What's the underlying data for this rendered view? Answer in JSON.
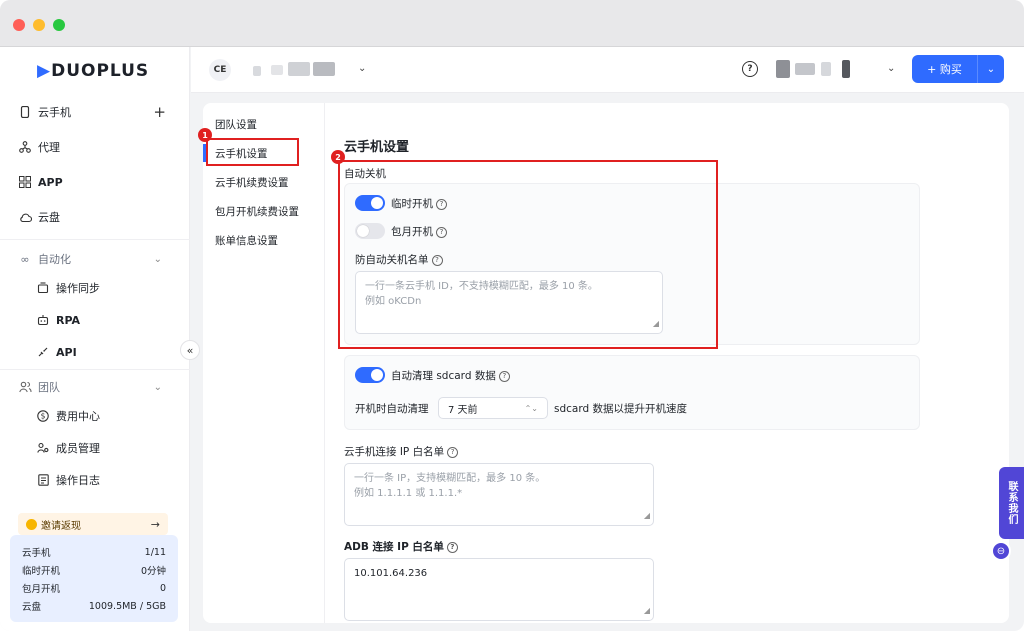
{
  "window": {
    "controls": [
      "close",
      "minimize",
      "maximize"
    ]
  },
  "sidebar": {
    "logo": "DUOPLUS",
    "items": [
      {
        "label": "云手机",
        "icon": "phone-icon",
        "action": "+"
      },
      {
        "label": "代理",
        "icon": "proxy-icon"
      },
      {
        "label": "APP",
        "icon": "grid-icon"
      },
      {
        "label": "云盘",
        "icon": "cloud-icon"
      }
    ],
    "automation": {
      "label": "自动化",
      "children": [
        {
          "label": "操作同步",
          "icon": "sync-icon"
        },
        {
          "label": "RPA",
          "icon": "robot-icon"
        },
        {
          "label": "API",
          "icon": "api-icon"
        }
      ]
    },
    "team": {
      "label": "团队",
      "children": [
        {
          "label": "费用中心",
          "icon": "dollar-icon"
        },
        {
          "label": "成员管理",
          "icon": "members-icon"
        },
        {
          "label": "操作日志",
          "icon": "log-icon"
        }
      ]
    },
    "collapse": "«",
    "invite": {
      "label": "邀请返现",
      "arrow": "→"
    },
    "stats": [
      {
        "label": "云手机",
        "value": "1/11"
      },
      {
        "label": "临时开机",
        "value": "0分钟"
      },
      {
        "label": "包月开机",
        "value": "0"
      },
      {
        "label": "云盘",
        "value": "1009.5MB / 5GB"
      }
    ]
  },
  "header": {
    "team_badge": "CE",
    "help": "?",
    "buy_label": "+ 购买"
  },
  "submenu": {
    "items": [
      "团队设置",
      "云手机设置",
      "云手机续费设置",
      "包月开机续费设置",
      "账单信息设置"
    ],
    "active_index": 1
  },
  "annotations": [
    "1",
    "2"
  ],
  "settings": {
    "title": "云手机设置",
    "auto_shutdown": {
      "label": "自动关机",
      "temp_boot": {
        "label": "临时开机",
        "enabled": true
      },
      "monthly_boot": {
        "label": "包月开机",
        "enabled": false
      },
      "whitelist_label": "防自动关机名单",
      "whitelist_placeholder_line1": "一行一条云手机 ID，不支持模糊匹配，最多 10 条。",
      "whitelist_placeholder_line2": "例如 oKCDn"
    },
    "sdcard": {
      "label": "自动清理 sdcard 数据",
      "enabled": true,
      "prefix": "开机时自动清理",
      "selected": "7 天前",
      "suffix": "sdcard 数据以提升开机速度"
    },
    "ip_whitelist": {
      "label": "云手机连接 IP 白名单",
      "placeholder_line1": "一行一条 IP，支持模糊匹配，最多 10 条。",
      "placeholder_line2": "例如 1.1.1.1 或 1.1.1.*"
    },
    "adb_whitelist": {
      "label": "ADB 连接 IP 白名单",
      "value": "10.101.64.236"
    }
  },
  "contact": {
    "label": "联系我们"
  },
  "colors": {
    "accent": "#2f6bff",
    "annotation": "#e02020",
    "contact": "#5146d6"
  }
}
